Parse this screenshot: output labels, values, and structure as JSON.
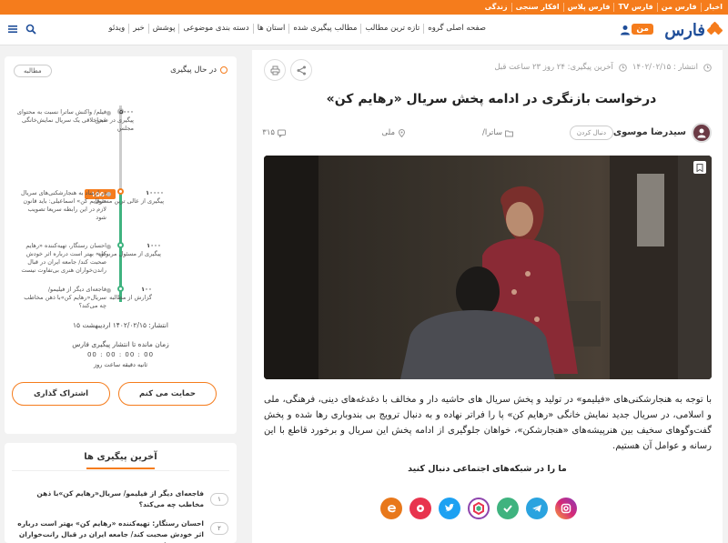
{
  "topbar": {
    "links": [
      "اخبار",
      "فارس من",
      "فارس TV",
      "فارس پلاس",
      "افکار سنجی",
      "زندگی"
    ]
  },
  "header": {
    "logo_text": "فارس",
    "man_badge": "من",
    "nav": [
      "صفحه اصلی گروه",
      "تازه ترین مطالب",
      "مطالب پیگیری شده",
      "استان ها",
      "دسته بندی موضوعی",
      "پوشش",
      "خبر",
      "ویدئو"
    ]
  },
  "article": {
    "meta": {
      "published": "انتشار : ۱۴۰۲/۰۲/۱۵",
      "last_followup": "آخرین پیگیری: ۲۴ روز ۲۳ ساعت قبل"
    },
    "title": "درخواست بازنگری در ادامه پخش سریال «رهایم کن»",
    "author": "سیدرضا موسوی",
    "follow_label": "دنبال کردن",
    "category": "ساترا/",
    "location": "ملی",
    "count": "۳۱۵",
    "body": "با توجه به هنجارشکنی‌های «فیلیمو» در تولید و پخش سریال های حاشیه دار و مخالف با دغدغه‌های دینی، فرهنگی، ملی و اسلامی، در سریال جدید نمایش خانگی «رهایم کن» پا را فراتر نهاده و به دنبال ترویج بی بندوباری رها شده و پخش گفت‌وگوهای سخیف بین هنرپیشه‌های «هنجارشکن»، خواهان جلوگیری از ادامه پخش این سریال و برخورد قاطع با این رسانه و عوامل آن هستیم.",
    "follow_us": "ما را در شبکه‌های اجتماعی دنبال کنید"
  },
  "socials": [
    {
      "name": "instagram-icon",
      "color": "#d62976"
    },
    {
      "name": "telegram-icon",
      "color": "#2aa3df"
    },
    {
      "name": "bale-icon",
      "color": "#3fb37f"
    },
    {
      "name": "rubika-icon",
      "color": "#8e44ad"
    },
    {
      "name": "twitter-icon",
      "color": "#1da1f2"
    },
    {
      "name": "aparat-icon",
      "color": "#e8344e"
    },
    {
      "name": "eitaa-icon",
      "color": "#f57c1c"
    }
  ],
  "tracker": {
    "status": "در حال پیگیری",
    "tag": "مطالبه",
    "ribbon": "۱۵۵۰",
    "steps": [
      {
        "num": "۵۰۰۰",
        "label": "پیگیری در صحن مجلس",
        "text": "فیلم/ واکنش ساترا نسبت به محتوای غیراخلاقی یک سریال نمایش‌خانگی"
      },
      {
        "num": "۱۰۰۰۰",
        "label": "پیگیری از عالی ترین مسئول",
        "text": "در ارشاد به هنجارشکنی‌های سریال «رهایم کن» اسماعیلی: باید قانون لازم در این رابطه سریعا تصویب شود"
      },
      {
        "num": "۱۰۰۰",
        "label": "پیگیری از مسئول مربوطه",
        "text": "احسان رستگار، تهیه‌کننده «رهایم کن» بهتر است درباره اثر خودش صحبت کند/ جامعه ایران در قبال راندن‌خواران هنری بی‌تفاوت نیست"
      },
      {
        "num": "۱۰۰",
        "label": "گزارش از مطالبه",
        "text": "فاجعه‌ای دیگر از فیلیمو/ سریال«رهایم کن»با ذهن مخاطب چه می‌کند؟"
      }
    ],
    "date_label": "انتشار: ۱۴۰۲/۰۲/۱۵ اردیبهشت ۱۵",
    "remaining_label": "زمان مانده تا انتشار پیگیری فارس",
    "countdown": "00 : 00 : 00 : 00",
    "countdown_units": "ثانیه دقیقه ساعت روز",
    "support_button": "حمایت می کنم",
    "share_button": "اشتراک گذاری"
  },
  "latest": {
    "title": "آخرین پیگیری ها",
    "items": [
      {
        "num": "۱",
        "text": "فاجعه‌ای دیگر از فیلیمو/ سریال«رهایم کن»با ذهن مخاطب چه می‌کند؟"
      },
      {
        "num": "۲",
        "text": "احسان رستگار: تهیه‌کننده «رهایم کن» بهتر است درباره اثر خودش صحبت کند/ جامعه ایران در قبال رانت‌خواران هنری بی‌تفاوت نیست"
      }
    ]
  }
}
